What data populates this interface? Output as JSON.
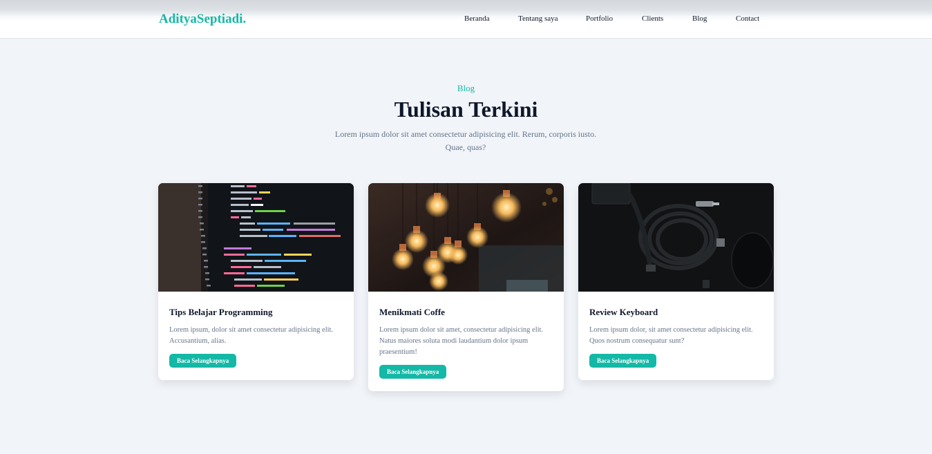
{
  "header": {
    "brand": "AdityaSeptiadi.",
    "nav": [
      "Beranda",
      "Tentang saya",
      "Portfolio",
      "Clients",
      "Blog",
      "Contact"
    ]
  },
  "blog": {
    "label": "Blog",
    "title": "Tulisan Terkini",
    "description": "Lorem ipsum dolor sit amet consectetur adipisicing elit. Rerum, corporis iusto. Quae, quas?",
    "posts": [
      {
        "title": "Tips Belajar Programming",
        "text": "Lorem ipsum, dolor sit amet consectetur adipisicing elit. Accusantium, alias.",
        "button": "Baca Selangkapnya",
        "image": "code-editor-photo"
      },
      {
        "title": "Menikmati Coffe",
        "text": "Lorem ipsum dolor sit amet, consectetur adipisicing elit. Natus maiores soluta modi laudantium dolor ipsum praesentium!",
        "button": "Baca Selangkapnya",
        "image": "hanging-bulbs-photo"
      },
      {
        "title": "Review Keyboard",
        "text": "Lorem ipsum dolor, sit amet consectetur adipisicing elit. Quos nostrum consequatur sunt?",
        "button": "Baca Selangkapnya",
        "image": "cable-mouse-photo"
      }
    ]
  },
  "colors": {
    "accent": "#14b8a6",
    "background": "#f1f4f8",
    "heading": "#0f172a",
    "muted": "#64748b"
  }
}
